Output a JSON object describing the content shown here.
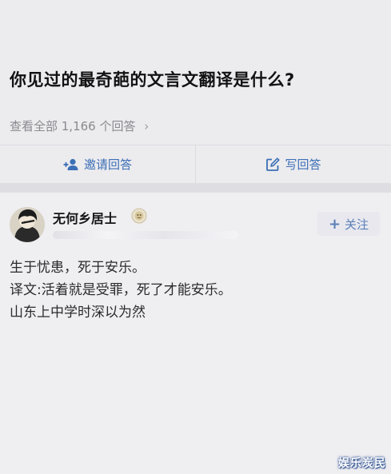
{
  "question": {
    "title": "你见过的最奇葩的文言文翻译是什么?",
    "answer_count": "查看全部 1,166 个回答",
    "chevron": "›"
  },
  "actions": {
    "invite_label": "邀请回答",
    "write_label": "写回答",
    "accent_color": "#3b6fb6"
  },
  "answer": {
    "author_name": "无何乡居士",
    "follow_label": "关注",
    "follow_plus": "+",
    "lines": [
      "生于忧患，死于安乐。",
      "译文:活着就是受罪，死了才能安乐。",
      "山东上中学时深以为然"
    ]
  },
  "icons": {
    "invite": "invite-person-icon",
    "write": "edit-icon",
    "badge": "badge-icon"
  },
  "watermark": "娱乐炭民"
}
